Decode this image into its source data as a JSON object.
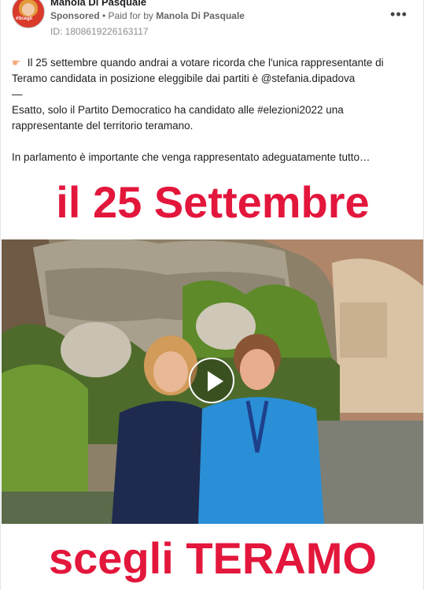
{
  "header": {
    "page_name": "Manola Di Pasquale",
    "sponsored": "Sponsored",
    "separator": " • ",
    "paid_for_prefix": "Paid for by ",
    "payer": "Manola Di Pasquale",
    "ad_id": "ID: 1808619226163117",
    "avatar_tag": "#Scegli"
  },
  "post": {
    "line1": "Il 25 settembre quando andrai a votare ricorda che l'unica rappresentante di",
    "line2": "Teramo candidata in posizione eleggibile dai partiti è @stefania.dipadova",
    "line3": "—",
    "line4": "Esatto, solo il Partito Democratico ha candidato alle #elezioni2022 una",
    "line5": "rappresentante del territorio teramano.",
    "line6": "In parlamento è importante che venga rappresentato adeguatamente tutto…"
  },
  "media": {
    "headline": "il 25 Settembre",
    "footer": "scegli TERAMO"
  },
  "colors": {
    "accent_red": "#e3163c",
    "muted_text": "#65676b"
  },
  "icons": {
    "hand": "backhand-index-pointing-right-icon",
    "more": "more-options-icon",
    "play": "play-icon"
  }
}
